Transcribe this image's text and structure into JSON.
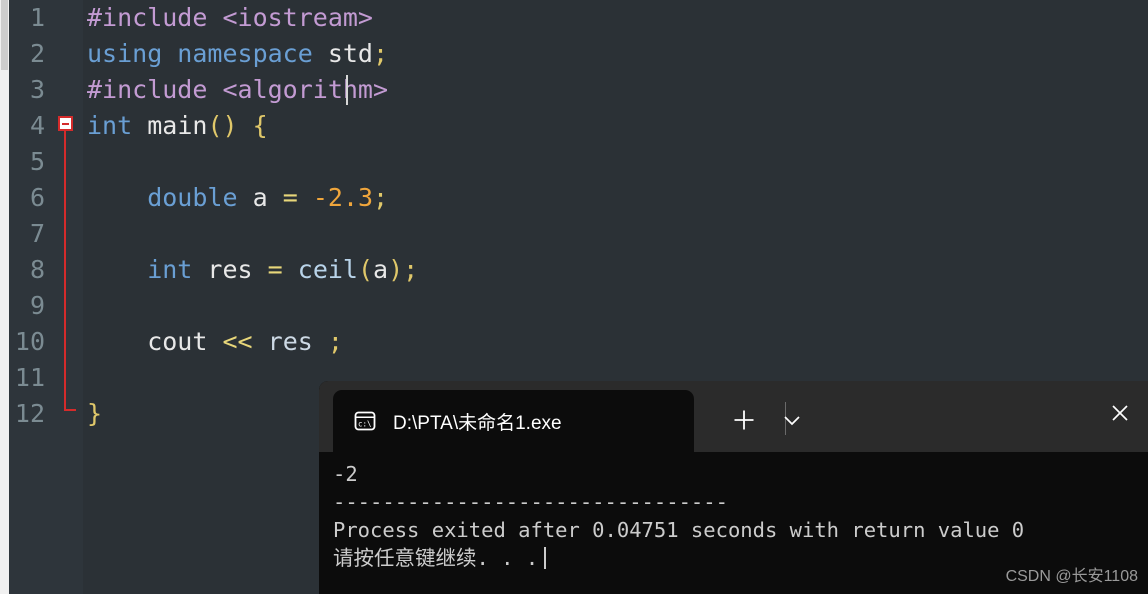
{
  "editor": {
    "language": "cpp",
    "background_color": "#2b3136",
    "gutter_color": "#2e353b",
    "fold_marker_color": "#d42b2b",
    "lines": [
      {
        "number": "1",
        "tokens": [
          {
            "t": "#include <iostream>",
            "c": "t-pre"
          }
        ]
      },
      {
        "number": "2",
        "tokens": [
          {
            "t": "using namespace ",
            "c": "t-kw"
          },
          {
            "t": "std",
            "c": "t-id"
          },
          {
            "t": ";",
            "c": "t-punc"
          }
        ]
      },
      {
        "number": "3",
        "tokens": [
          {
            "t": "#include <algorithm>",
            "c": "t-pre"
          }
        ]
      },
      {
        "number": "4",
        "tokens": [
          {
            "t": "int ",
            "c": "t-kw"
          },
          {
            "t": "main",
            "c": "t-id"
          },
          {
            "t": "()",
            "c": "t-punc"
          },
          {
            "t": " ",
            "c": "t-id"
          },
          {
            "t": "{",
            "c": "t-punc"
          }
        ]
      },
      {
        "number": "5",
        "tokens": [
          {
            "t": "",
            "c": "t-id"
          }
        ]
      },
      {
        "number": "6",
        "tokens": [
          {
            "t": "    double ",
            "c": "t-kw"
          },
          {
            "t": "a",
            "c": "t-id"
          },
          {
            "t": " ",
            "c": "t-id"
          },
          {
            "t": "=",
            "c": "t-op"
          },
          {
            "t": " ",
            "c": "t-id"
          },
          {
            "t": "-",
            "c": "t-num"
          },
          {
            "t": "2.3",
            "c": "t-num"
          },
          {
            "t": ";",
            "c": "t-punc"
          }
        ]
      },
      {
        "number": "7",
        "tokens": [
          {
            "t": "",
            "c": "t-id"
          }
        ]
      },
      {
        "number": "8",
        "tokens": [
          {
            "t": "    int ",
            "c": "t-kw"
          },
          {
            "t": "res",
            "c": "t-id"
          },
          {
            "t": " ",
            "c": "t-id"
          },
          {
            "t": "=",
            "c": "t-op"
          },
          {
            "t": " ",
            "c": "t-id"
          },
          {
            "t": "ceil",
            "c": "t-fn"
          },
          {
            "t": "(",
            "c": "t-punc"
          },
          {
            "t": "a",
            "c": "t-id"
          },
          {
            "t": ")",
            "c": "t-punc"
          },
          {
            "t": ";",
            "c": "t-punc"
          }
        ]
      },
      {
        "number": "9",
        "tokens": [
          {
            "t": "",
            "c": "t-id"
          }
        ]
      },
      {
        "number": "10",
        "tokens": [
          {
            "t": "    cout",
            "c": "t-id"
          },
          {
            "t": " ",
            "c": "t-id"
          },
          {
            "t": "<<",
            "c": "t-op"
          },
          {
            "t": " ",
            "c": "t-id"
          },
          {
            "t": "res",
            "c": "t-var"
          },
          {
            "t": " ",
            "c": "t-id"
          },
          {
            "t": ";",
            "c": "t-punc"
          }
        ]
      },
      {
        "number": "11",
        "tokens": [
          {
            "t": "",
            "c": "t-id"
          }
        ]
      },
      {
        "number": "12",
        "tokens": [
          {
            "t": "}",
            "c": "t-punc"
          }
        ]
      }
    ],
    "fold": {
      "collapse_line": "4",
      "end_line": "12",
      "state": "expanded"
    },
    "caret": {
      "line": "3",
      "after_text": "#include <algorithm"
    }
  },
  "terminal": {
    "tab": {
      "title": "D:\\PTA\\未命名1.exe",
      "icon": "cmd-prompt-icon",
      "close_icon": "close-icon"
    },
    "new_tab_icon": "plus-icon",
    "dropdown_icon": "chevron-down-icon",
    "output": [
      "-2",
      "--------------------------------",
      "Process exited after 0.04751 seconds with return value 0",
      "请按任意键继续. . ."
    ]
  },
  "watermark": {
    "text": "CSDN @长安1108"
  }
}
